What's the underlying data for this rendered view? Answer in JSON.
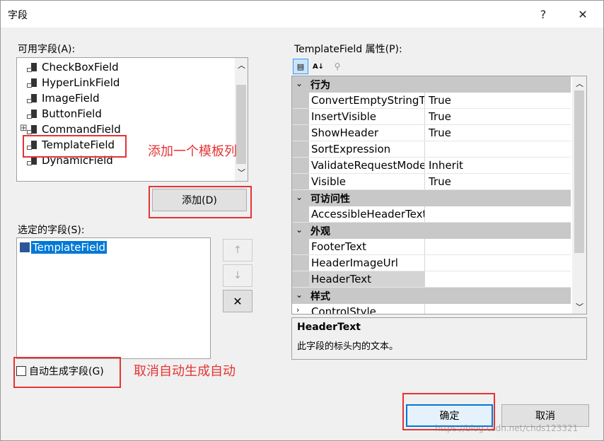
{
  "window": {
    "title": "字段",
    "help_label": "?",
    "close_label": "✕"
  },
  "available_fields": {
    "label": "可用字段(A):",
    "items": [
      {
        "label": "CheckBoxField",
        "icon": "checkbox-field-icon"
      },
      {
        "label": "HyperLinkField",
        "icon": "hyperlink-field-icon"
      },
      {
        "label": "ImageField",
        "icon": "image-field-icon"
      },
      {
        "label": "ButtonField",
        "icon": "button-field-icon"
      },
      {
        "label": "CommandField",
        "icon": "command-field-icon",
        "expander": "⊞"
      },
      {
        "label": "TemplateField",
        "icon": "template-field-icon"
      },
      {
        "label": "DynamicField",
        "icon": "dynamic-field-icon"
      }
    ],
    "add_button": "添加(D)"
  },
  "selected_fields": {
    "label": "选定的字段(S):",
    "items": [
      {
        "label": "TemplateField"
      }
    ],
    "move_up": "↑",
    "move_down": "↓",
    "delete": "✕",
    "auto_generate": "自动生成字段(G)"
  },
  "properties": {
    "label": "TemplateField 属性(P):",
    "categories": [
      {
        "name": "行为",
        "rows": [
          {
            "name": "ConvertEmptyStringTo",
            "value": "True"
          },
          {
            "name": "InsertVisible",
            "value": "True"
          },
          {
            "name": "ShowHeader",
            "value": "True"
          },
          {
            "name": "SortExpression",
            "value": ""
          },
          {
            "name": "ValidateRequestMode",
            "value": "Inherit"
          },
          {
            "name": "Visible",
            "value": "True"
          }
        ]
      },
      {
        "name": "可访问性",
        "rows": [
          {
            "name": "AccessibleHeaderText",
            "value": ""
          }
        ]
      },
      {
        "name": "外观",
        "rows": [
          {
            "name": "FooterText",
            "value": ""
          },
          {
            "name": "HeaderImageUrl",
            "value": ""
          },
          {
            "name": "HeaderText",
            "value": ""
          }
        ]
      },
      {
        "name": "样式",
        "rows": [
          {
            "name": "ControlStyle",
            "value": ""
          }
        ]
      }
    ],
    "description_title": "HeaderText",
    "description_text": "此字段的标头内的文本。"
  },
  "annotations": {
    "add_template": "添加一个模板列",
    "cancel_auto": "取消自动生成自动"
  },
  "buttons": {
    "ok": "确定",
    "cancel": "取消"
  },
  "watermark": "https://blog.csdn.net/chds123321",
  "colors": {
    "highlight": "#e53333",
    "selection": "#0078d7"
  }
}
